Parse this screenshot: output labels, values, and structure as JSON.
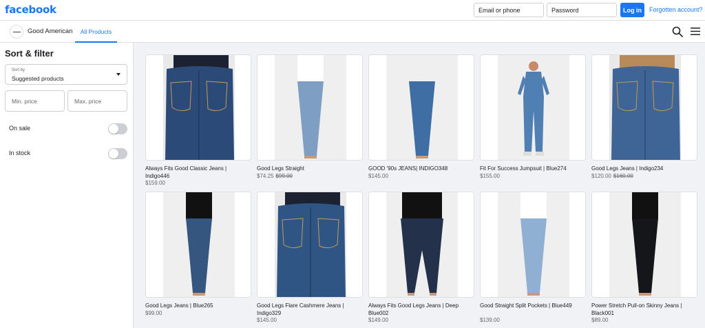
{
  "header": {
    "logo": "facebook",
    "email_placeholder": "Email or phone",
    "password_placeholder": "Password",
    "login_label": "Log in",
    "forgot_label": "Forgotten account?"
  },
  "shop": {
    "name": "Good American",
    "tab_all": "All Products"
  },
  "filters": {
    "title": "Sort & filter",
    "sort_label": "Sort by",
    "sort_value": "Suggested products",
    "min_price_placeholder": "Min. price",
    "max_price_placeholder": "Max. price",
    "on_sale_label": "On sale",
    "in_stock_label": "In stock"
  },
  "products": [
    {
      "title": "Always Fits Good Classic Jeans | Indigo446",
      "price": "$159.00",
      "old_price": "",
      "photo": "back-closeup",
      "wash": "#2b4a78"
    },
    {
      "title": "Good Legs Straight",
      "price": "$74.25",
      "old_price": "$99.00",
      "photo": "full-back",
      "wash": "#7f9ec4"
    },
    {
      "title": "GOOD '90s JEANS| INDIGO348",
      "price": "$145.00",
      "old_price": "",
      "photo": "full-front",
      "wash": "#3f6ea4"
    },
    {
      "title": "Fit For Success Jumpsuit | Blue274",
      "price": "$155.00",
      "old_price": "",
      "photo": "jumpsuit",
      "wash": "#4f7fb3"
    },
    {
      "title": "Good Legs Jeans | Indigo234",
      "price": "$120.00",
      "old_price": "$160.00",
      "photo": "back-closeup-tan",
      "wash": "#3e6596"
    },
    {
      "title": "Good Legs Jeans | Blue265",
      "price": "$99.00",
      "old_price": "",
      "photo": "full-front-dark",
      "wash": "#35577f"
    },
    {
      "title": "Good Legs Flare Cashmere Jeans | Indigo329",
      "price": "$145.00",
      "old_price": "",
      "photo": "back-closeup",
      "wash": "#2f5584"
    },
    {
      "title": "Always Fits Good Legs Jeans | Deep Blue002",
      "price": "$149.00",
      "old_price": "",
      "photo": "curvy-front",
      "wash": "#23324a"
    },
    {
      "title": "Good Straight Split Pockets | Blue449",
      "price": "$139.00",
      "old_price": "",
      "photo": "full-back-light",
      "wash": "#8fb0d2"
    },
    {
      "title": "Power Stretch Pull-on Skinny Jeans | Black001",
      "price": "$89.00",
      "old_price": "",
      "photo": "full-black",
      "wash": "#15161a"
    }
  ]
}
